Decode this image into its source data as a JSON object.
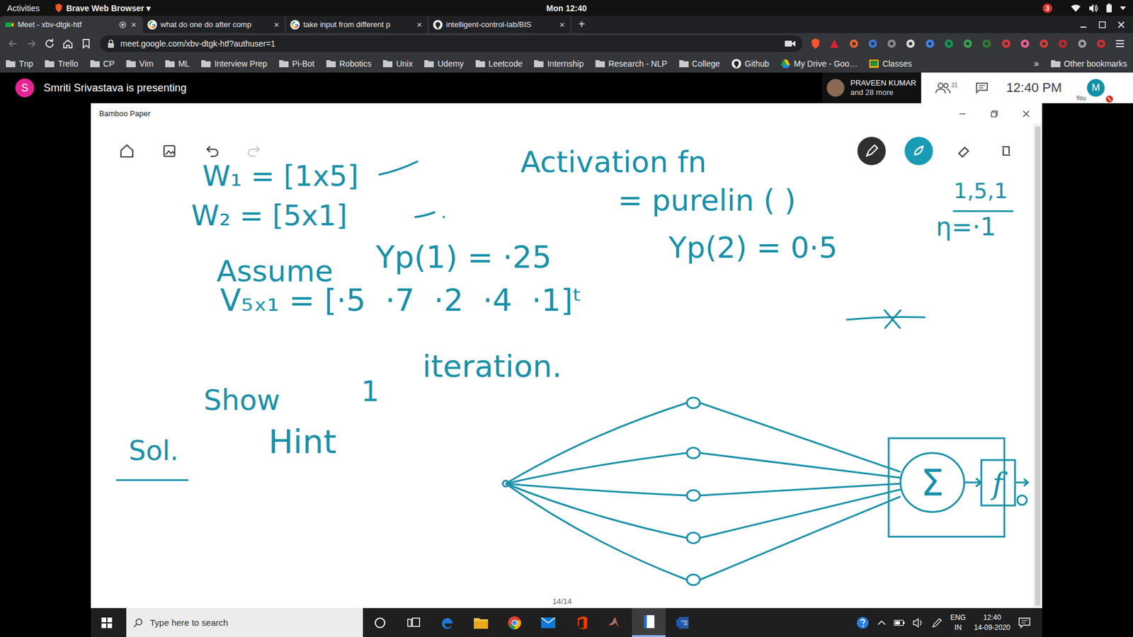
{
  "topbar": {
    "activities": "Activities",
    "app": "Brave Web Browser ▾",
    "clock": "Mon 12:40",
    "badge": "3"
  },
  "browser": {
    "tabs": [
      {
        "label": "Meet - xbv-dtgk-htf",
        "selected": true,
        "recording": true,
        "kind": "meet"
      },
      {
        "label": "what do one do after comp",
        "selected": false,
        "recording": false,
        "kind": "google"
      },
      {
        "label": "take input from different p",
        "selected": false,
        "recording": false,
        "kind": "google"
      },
      {
        "label": "intelligent-control-lab/BIS",
        "selected": false,
        "recording": false,
        "kind": "github"
      }
    ],
    "tab_close": "×",
    "new_tab": "+",
    "url": "meet.google.com/xbv-dtgk-htf?authuser=1",
    "bookmarks": [
      {
        "label": "Tnp",
        "kind": "folder"
      },
      {
        "label": "Trello",
        "kind": "folder"
      },
      {
        "label": "CP",
        "kind": "folder"
      },
      {
        "label": "Vim",
        "kind": "folder"
      },
      {
        "label": "ML",
        "kind": "folder"
      },
      {
        "label": "Interview Prep",
        "kind": "folder"
      },
      {
        "label": "Pi-Bot",
        "kind": "folder"
      },
      {
        "label": "Robotics",
        "kind": "folder"
      },
      {
        "label": "Unix",
        "kind": "folder"
      },
      {
        "label": "Udemy",
        "kind": "folder"
      },
      {
        "label": "Leetcode",
        "kind": "folder"
      },
      {
        "label": "Internship",
        "kind": "folder"
      },
      {
        "label": "Research - NLP",
        "kind": "folder"
      },
      {
        "label": "College",
        "kind": "folder"
      },
      {
        "label": "Github",
        "kind": "github"
      },
      {
        "label": "My Drive - Goo…",
        "kind": "drive"
      },
      {
        "label": "Classes",
        "kind": "classroom"
      }
    ],
    "more_bookmarks": "»",
    "other_bookmarks": "Other bookmarks"
  },
  "meet": {
    "presenter_initial": "S",
    "presenting": "Smriti Srivastava is presenting",
    "participant": "PRAVEEN KUMAR",
    "participant_more": "and 28 more",
    "people_count": "31",
    "time": "12:40 PM",
    "you_initial": "M",
    "you_label": "You"
  },
  "app_window": {
    "title": "Bamboo Paper",
    "page": "14/14"
  },
  "notes": [
    {
      "text": "W₁ = [1x5]"
    },
    {
      "text": "W₂ = [5x1]"
    },
    {
      "text": "Activation fn"
    },
    {
      "text": "= purelin ( )"
    },
    {
      "text": "1,5,1"
    },
    {
      "text": "η=·1"
    },
    {
      "text": "Assume"
    },
    {
      "text": "Yp(1) = ·25"
    },
    {
      "text": "Yp(2) = 0·5"
    },
    {
      "text": "V₅ₓ₁ = [·5  ·7  ·2  ·4  ·1]ᵗ"
    },
    {
      "text": "Show"
    },
    {
      "text": "1"
    },
    {
      "text": "iteration."
    },
    {
      "text": "Sol."
    },
    {
      "text": "Hint"
    }
  ],
  "diagram": {
    "sum": "Σ",
    "activation": "f"
  },
  "taskbar": {
    "search_placeholder": "Type here to search",
    "apps": [
      {
        "kind": "cortana",
        "selected": false
      },
      {
        "kind": "taskview",
        "selected": false
      },
      {
        "kind": "edge",
        "selected": false
      },
      {
        "kind": "explorer",
        "selected": false
      },
      {
        "kind": "chrome",
        "selected": false
      },
      {
        "kind": "mail",
        "selected": false
      },
      {
        "kind": "office",
        "selected": false
      },
      {
        "kind": "matlab",
        "selected": false
      },
      {
        "kind": "bamboo",
        "selected": true
      },
      {
        "kind": "word",
        "selected": false
      }
    ],
    "lang": "ENG",
    "region": "IN",
    "time": "12:40",
    "date": "14-09-2020"
  }
}
